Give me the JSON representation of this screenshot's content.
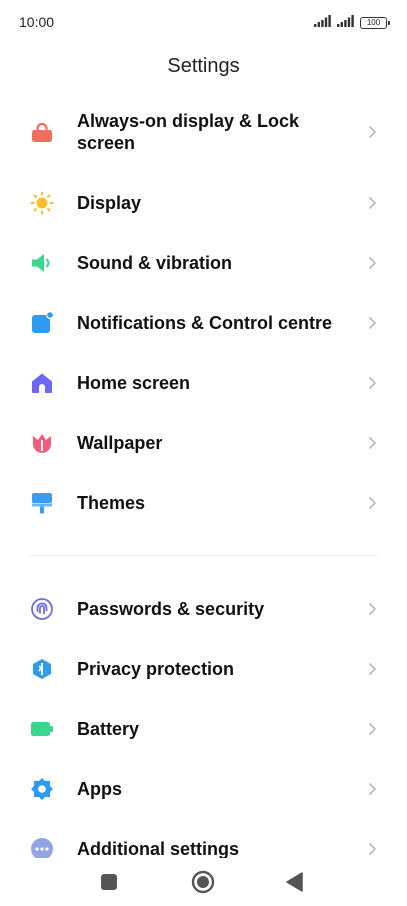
{
  "status_bar": {
    "time": "10:00",
    "battery_level": "100"
  },
  "header": {
    "title": "Settings"
  },
  "settings": {
    "group1": [
      {
        "label": "Always-on display & Lock screen",
        "icon": "lock-icon",
        "color": "#f36e5f"
      },
      {
        "label": "Display",
        "icon": "sun-icon",
        "color": "#f7be2a"
      },
      {
        "label": "Sound & vibration",
        "icon": "speaker-icon",
        "color": "#3ad58f"
      },
      {
        "label": "Notifications & Control centre",
        "icon": "notification-icon",
        "color": "#2d9bf0"
      },
      {
        "label": "Home screen",
        "icon": "home-icon",
        "color": "#6d67f3"
      },
      {
        "label": "Wallpaper",
        "icon": "tulip-icon",
        "color": "#f45b7c"
      },
      {
        "label": "Themes",
        "icon": "paint-brush-icon",
        "color": "#3b9cf6"
      }
    ],
    "group2": [
      {
        "label": "Passwords & security",
        "icon": "fingerprint-icon",
        "color": "#6b6ee0"
      },
      {
        "label": "Privacy protection",
        "icon": "shield-icon",
        "color": "#2d9bf0"
      },
      {
        "label": "Battery",
        "icon": "battery-icon",
        "color": "#3ad58f"
      },
      {
        "label": "Apps",
        "icon": "gear-icon",
        "color": "#2d9bf0"
      },
      {
        "label": "Additional settings",
        "icon": "more-icon",
        "color": "#8fa6e3"
      }
    ]
  },
  "nav_bar": {
    "recents": "square-icon",
    "home": "circle-icon",
    "back": "triangle-back-icon"
  }
}
